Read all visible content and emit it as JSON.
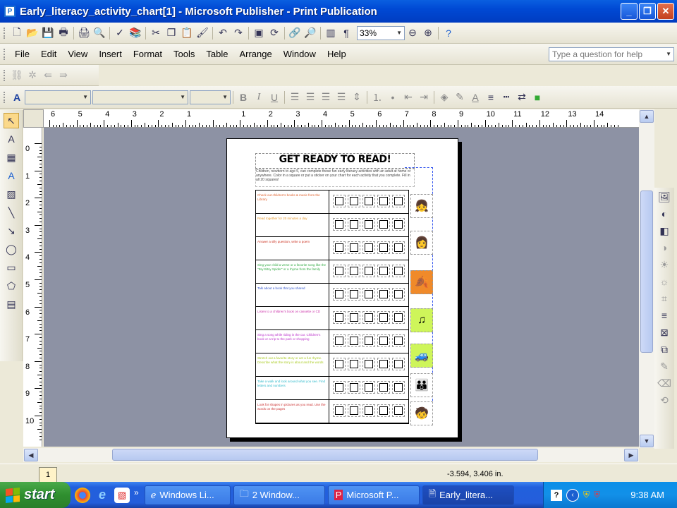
{
  "window": {
    "title": "Early_literacy_activity_chart[1] - Microsoft Publisher - Print Publication",
    "buttons": [
      "_",
      "❐",
      "✕"
    ]
  },
  "standard_toolbar": {
    "zoom_value": "33%",
    "icons": [
      "new-icon",
      "open-icon",
      "save-icon",
      "permission-icon",
      "print-icon",
      "print-preview-icon",
      "spelling-icon",
      "research-icon",
      "cut-icon",
      "copy-icon",
      "paste-icon",
      "format-painter-icon",
      "undo-icon",
      "redo-icon",
      "arrange-icon",
      "rotate-icon",
      "hyperlink-icon",
      "find-icon",
      "columns-icon",
      "paragraph-mark-icon",
      "zoom-out-icon",
      "zoom-in-icon",
      "help-icon"
    ]
  },
  "menu": {
    "items": [
      "File",
      "Edit",
      "View",
      "Insert",
      "Format",
      "Tools",
      "Table",
      "Arrange",
      "Window",
      "Help"
    ],
    "help_placeholder": "Type a question for help"
  },
  "formatting_toolbar": {
    "bold": "B",
    "italic": "I",
    "underline": "U"
  },
  "rulers": {
    "horizontal": [
      "6",
      "5",
      "4",
      "3",
      "2",
      "1",
      "",
      "1",
      "2",
      "3",
      "4",
      "5",
      "6",
      "7",
      "8",
      "9",
      "10",
      "11",
      "12",
      "13",
      "14"
    ],
    "vertical": [
      "0",
      "1",
      "2",
      "3",
      "4",
      "5",
      "6",
      "7",
      "8",
      "9",
      "10"
    ]
  },
  "document": {
    "title": "GET READY TO READ!",
    "intro": "Children, newborn to age 5, can complete these fun early literacy activities with an adult at home or anywhere. Color in a square or put a sticker on your chart for each activity that you complete. Fill in all 20 squares!",
    "rows": [
      {
        "text": "Check out children's books & music from the Library",
        "color": "#e0602a"
      },
      {
        "text": "Read together for 20 minutes a day",
        "color": "#e69a30"
      },
      {
        "text": "Answer a silly question, write a poem",
        "color": "#cc3322"
      },
      {
        "text": "Sing your child a verse or a favorite song like the \"Itsy Bitsy Spider\" or a rhyme from the family",
        "color": "#33aa44"
      },
      {
        "text": "Talk about a book that you shared",
        "color": "#3355cc"
      },
      {
        "text": "Listen to a children's book on cassette or CD",
        "color": "#cc33aa"
      },
      {
        "text": "Sing a song while riding in the car. Children's book or a trip to the park or shopping",
        "color": "#bb33cc"
      },
      {
        "text": "Stretch out a favorite story or act a fun rhyme. Describe what the story is about and the words",
        "color": "#aacc22"
      },
      {
        "text": "Take a walk and look around what you see. Find letters and numbers",
        "color": "#33bbcc"
      },
      {
        "text": "Look for shapes in pictures as you read. Use the words on the pages",
        "color": "#cc3333"
      }
    ],
    "boxes_per_row": 5,
    "clipart": [
      "girl-reading-icon",
      "mother-child-icon",
      "autumn-leaves-icon",
      "music-note-icon",
      "car-icon",
      "family-walk-icon",
      "children-icon"
    ]
  },
  "status": {
    "page_number": "1",
    "coordinates": "-3.594, 3.406 in."
  },
  "taskbar": {
    "start": "start",
    "tasks": [
      "Windows Li...",
      "2 Window...",
      "Microsoft P...",
      "Early_litera..."
    ],
    "time": "9:38 AM",
    "chevron": "»"
  }
}
